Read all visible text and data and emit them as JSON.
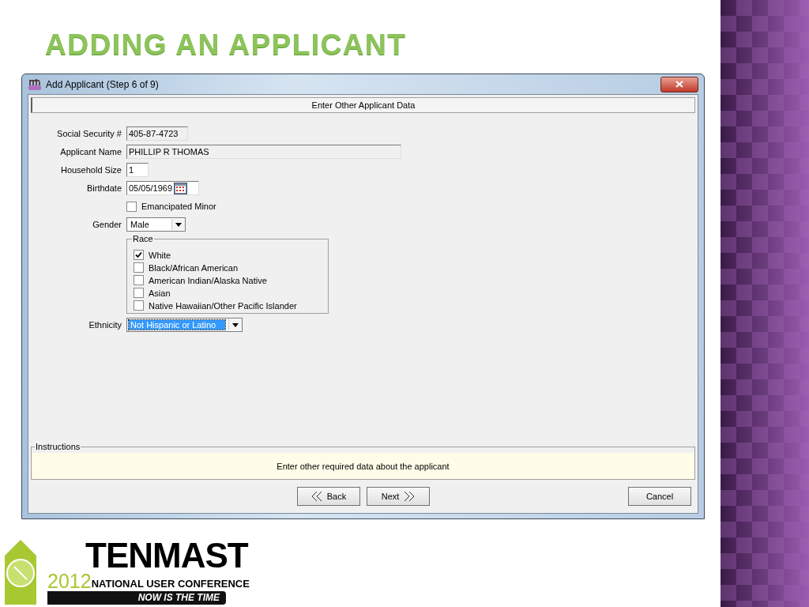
{
  "slide_title": "ADDING AN APPLICANT",
  "window": {
    "title": "Add Applicant (Step 6 of 9)",
    "header": "Enter Other Applicant Data",
    "fields": [
      {
        "kind": "text",
        "label": "Social Security #",
        "value": "405-87-4723",
        "disabled": true
      },
      {
        "kind": "text",
        "label": "Applicant Name",
        "value": "PHILLIP R THOMAS",
        "disabled": true
      },
      {
        "kind": "text",
        "label": "Household Size",
        "value": "1",
        "disabled": false
      },
      {
        "kind": "date",
        "label": "Birthdate",
        "value": "05/05/1969"
      },
      {
        "kind": "checkbox",
        "label": "Emancipated Minor",
        "checked": false
      },
      {
        "kind": "dropdown",
        "label": "Gender",
        "value": "Male",
        "focused": false
      },
      {
        "kind": "group",
        "label": "Race",
        "options": [
          {
            "label": "White",
            "checked": true
          },
          {
            "label": "Black/African American",
            "checked": false
          },
          {
            "label": "American Indian/Alaska Native",
            "checked": false
          },
          {
            "label": "Asian",
            "checked": false
          },
          {
            "label": "Native Hawaiian/Other Pacific Islander",
            "checked": false
          }
        ]
      },
      {
        "kind": "dropdown",
        "label": "Ethnicity",
        "value": "Not Hispanic or Latino",
        "focused": true
      }
    ],
    "instructions": {
      "label": "Instructions",
      "text": "Enter other required data about the applicant"
    },
    "buttons": {
      "back": "Back",
      "next": "Next",
      "cancel": "Cancel"
    }
  },
  "logo": {
    "name": "TENMAST",
    "year": "2012",
    "subtitle": "NATIONAL USER CONFERENCE",
    "slogan": "NOW IS THE TIME"
  }
}
